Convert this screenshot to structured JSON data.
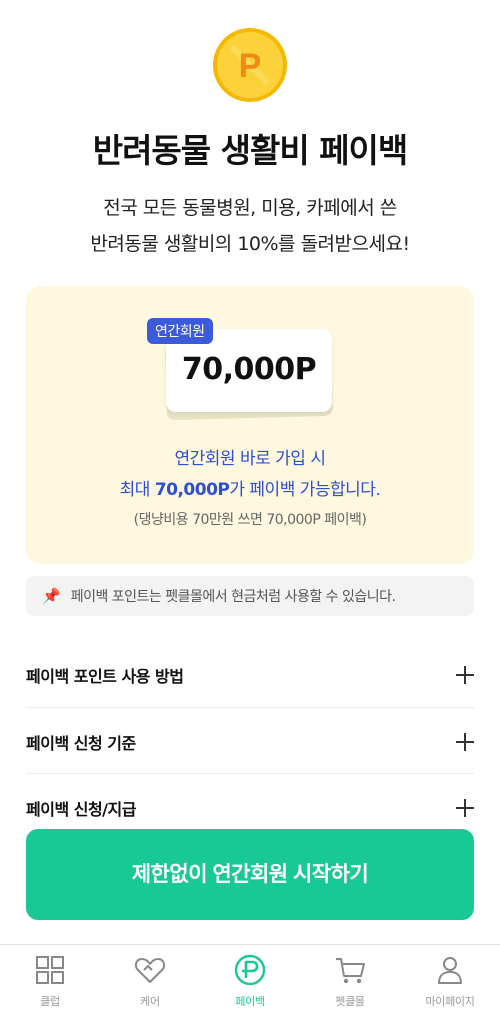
{
  "header": {
    "coin_icon": "point-coin-icon",
    "coin_letter": "P",
    "title": "반려동물 생활비 페이백",
    "subtitle_line1": "전국 모든 동물병원, 미용, 카페에서 쓴",
    "subtitle_line2": "반려동물 생활비의 10%를 돌려받으세요!"
  },
  "promo": {
    "badge": "연간회원",
    "amount": "70,000P",
    "line1": "연간회원 바로 가입 시",
    "line2_prefix": "최대 ",
    "line2_amount": "70,000P",
    "line2_suffix": "가 페이백 가능합니다.",
    "note": "(댕냥비용 70만원 쓰면 70,000P 페이백)"
  },
  "notice": {
    "icon": "pushpin-icon",
    "text": "페이백 포인트는 펫클몰에서 현금처럼 사용할 수 있습니다."
  },
  "faq": [
    {
      "label": "페이백 포인트 사용 방법"
    },
    {
      "label": "페이백 신청 기준"
    },
    {
      "label": "페이백 신청/지급"
    }
  ],
  "cta": {
    "label": "제한없이 연간회원 시작하기"
  },
  "tabs": [
    {
      "label": "클럽",
      "icon": "grid-icon"
    },
    {
      "label": "케어",
      "icon": "heart-icon"
    },
    {
      "label": "페이백",
      "icon": "payback-icon"
    },
    {
      "label": "펫클몰",
      "icon": "cart-icon"
    },
    {
      "label": "마이페이지",
      "icon": "person-icon"
    }
  ],
  "colors": {
    "accent": "#18c995",
    "promo_bg": "#fdf8df",
    "badge_blue": "#3b5bdb",
    "coin": "#f7c21b"
  }
}
